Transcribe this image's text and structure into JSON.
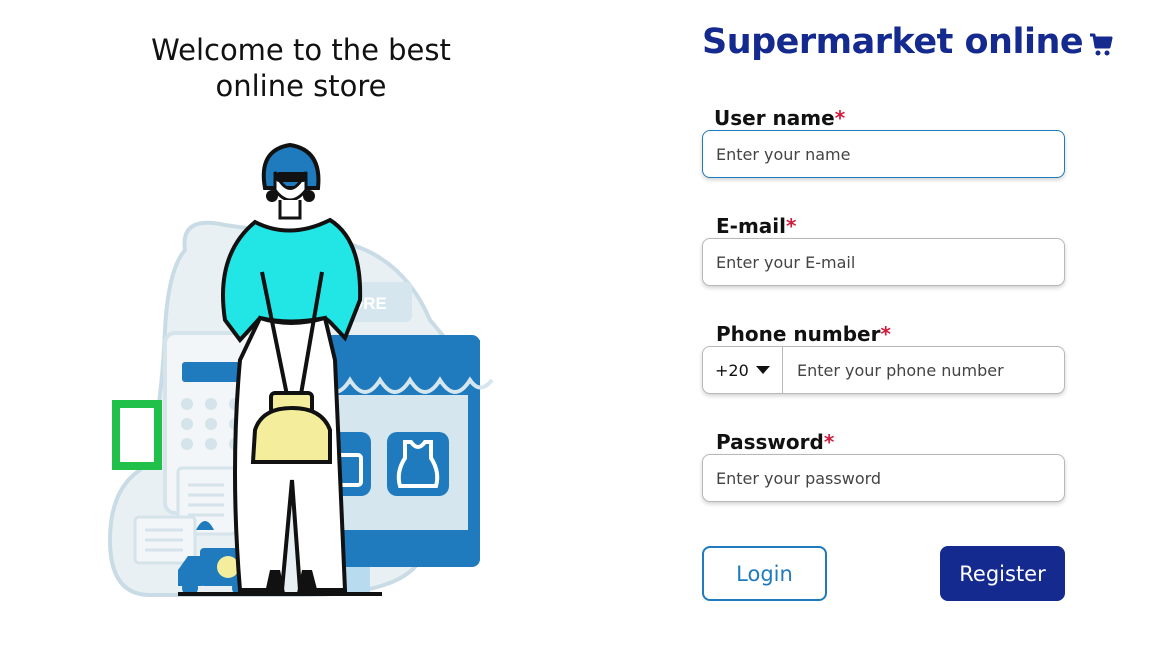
{
  "welcome": {
    "line1": "Welcome to the best",
    "line2": "online store"
  },
  "brand": {
    "title": "Supermarket online",
    "icon": "shopping-cart-icon"
  },
  "illustration": {
    "store_sign": "ORE"
  },
  "form": {
    "username": {
      "label": "User name",
      "required_mark": "*",
      "placeholder": "Enter your name"
    },
    "email": {
      "label": "E-mail",
      "required_mark": "*",
      "placeholder": "Enter your E-mail"
    },
    "phone": {
      "label": "Phone number",
      "required_mark": "*",
      "country_code": "+20",
      "placeholder": "Enter your phone number"
    },
    "password": {
      "label": "Password",
      "required_mark": "*",
      "placeholder": "Enter your password"
    }
  },
  "buttons": {
    "login": "Login",
    "register": "Register"
  },
  "colors": {
    "brand": "#142a8f",
    "accent": "#1f7bbd",
    "required": "#d11a3c",
    "figure_top": "#22e6e6",
    "bag": "#f4ee9c"
  }
}
